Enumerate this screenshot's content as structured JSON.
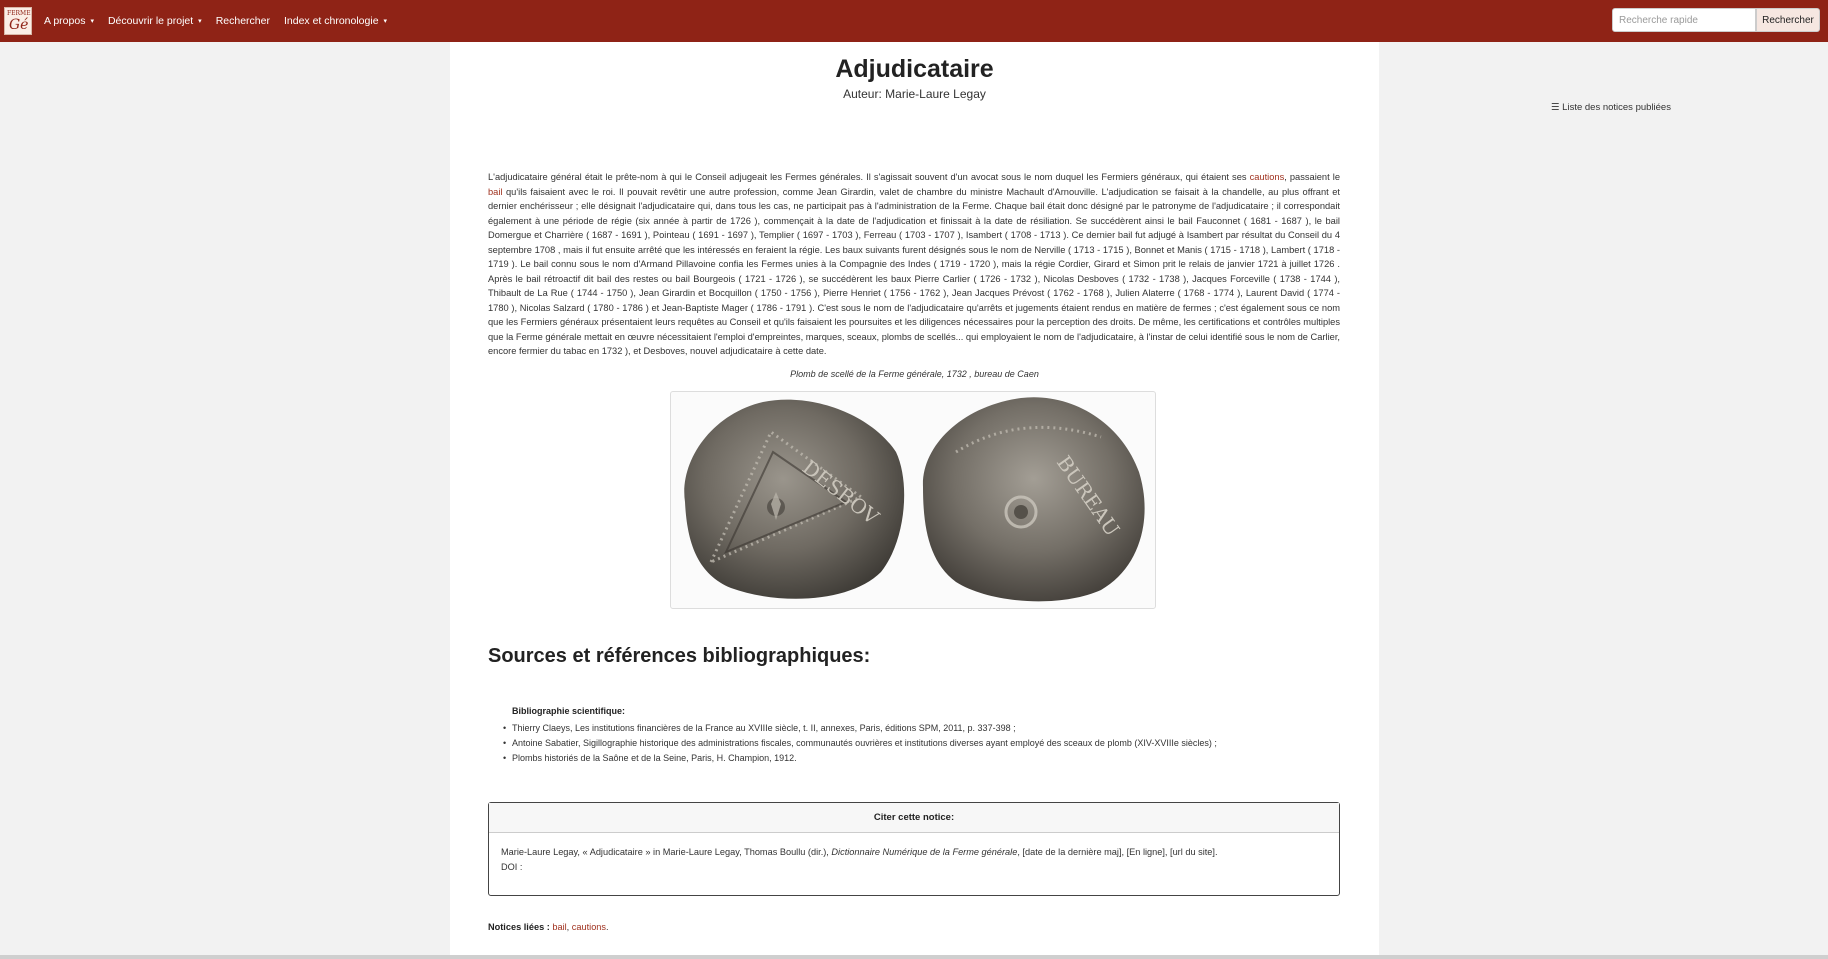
{
  "navbar": {
    "logo_top": "FERME",
    "logo_main": "Gé",
    "items": [
      {
        "label": "A propos",
        "dropdown": true
      },
      {
        "label": "Découvrir le projet",
        "dropdown": true
      },
      {
        "label": "Rechercher",
        "dropdown": false
      },
      {
        "label": "Index et chronologie",
        "dropdown": true
      }
    ],
    "caret": "▾",
    "search_placeholder": "Recherche rapide",
    "search_button": "Rechercher"
  },
  "colors": {
    "navbar": "#8f2316",
    "link": "#a0321f"
  },
  "article": {
    "title": "Adjudicataire",
    "author": "Auteur: Marie-Laure Legay",
    "body": {
      "p1": "L'adjudicataire général était le prête-nom à qui le Conseil adjugeait les Fermes générales. Il s'agissait souvent d'un avocat sous le nom duquel les Fermiers généraux, qui étaient ses ",
      "link_cautions": "cautions",
      "p2": ", passaient le ",
      "link_bail": "bail",
      "p3": " qu'ils faisaient avec le roi. Il pouvait revêtir une autre profession, comme Jean Girardin, valet de chambre du ministre Machault d'Arnouville. L'adjudication se faisait à la chandelle, au plus offrant et dernier enchérisseur ; elle désignait l'adjudicataire qui, dans tous les cas, ne participait pas à l'administration de la Ferme. Chaque bail était donc désigné par le patronyme de l'adjudicataire ; il correspondait également à une période de régie (six année à partir de 1726 ), commençait à la date de l'adjudication et finissait à la date de résiliation. Se succédèrent ainsi le bail Fauconnet ( 1681 - 1687 ), le bail Domergue et Charrière ( 1687 - 1691 ), Pointeau ( 1691 - 1697 ), Templier ( 1697 - 1703 ), Ferreau ( 1703 - 1707 ), Isambert ( 1708 - 1713 ). Ce dernier bail fut adjugé à Isambert par résultat du Conseil du 4 septembre 1708 , mais il fut ensuite arrêté que les intéressés en feraient la régie. Les baux suivants furent désignés sous le nom de Nerville ( 1713 - 1715 ), Bonnet et Manis ( 1715 - 1718 ), Lambert ( 1718 - 1719 ). Le bail connu sous le nom d'Armand Pillavoine confia les Fermes unies à la Compagnie des Indes ( 1719 - 1720 ), mais la régie Cordier, Girard et Simon prit le relais de janvier 1721 à juillet 1726 . Après le bail rétroactif dit bail des restes ou bail Bourgeois ( 1721 - 1726 ), se succédèrent les baux Pierre Carlier ( 1726 - 1732 ), Nicolas Desboves ( 1732 - 1738 ), Jacques Forceville ( 1738 - 1744 ), Thibault de La Rue ( 1744 - 1750 ), Jean Girardin et Bocquillon ( 1750 - 1756 ), Pierre Henriet ( 1756 - 1762 ), Jean Jacques Prévost ( 1762 - 1768 ), Julien Alaterre ( 1768 - 1774 ), Laurent David ( 1774 - 1780 ), Nicolas Salzard ( 1780 - 1786 ) et Jean-Baptiste Mager ( 1786 - 1791 ). C'est sous le nom de l'adjudicataire qu'arrêts et jugements étaient rendus en matière de fermes ; c'est également sous ce nom que les Fermiers généraux présentaient leurs requêtes au Conseil et qu'ils faisaient les poursuites et les diligences nécessaires pour la perception des droits. De même, les certifications et contrôles multiples que la Ferme générale mettait en œuvre nécessitaient l'emploi d'empreintes, marques, sceaux, plombs de scellés... qui employaient le nom de l'adjudicataire, à l'instar de celui identifié sous le nom de Carlier, encore fermier du tabac en 1732 ), et Desboves, nouvel adjudicataire à cette date."
    },
    "image_caption": "Plomb de scellé de la Ferme générale, 1732 , bureau de Caen",
    "left_seal_text": "DESBOV",
    "right_seal_text": "BUREAU"
  },
  "sources": {
    "heading": "Sources et références bibliographiques:",
    "subheading": "Bibliographie scientifique:",
    "items": [
      "Thierry Claeys, Les institutions financières de la France au XVIIIe siècle, t. II, annexes, Paris, éditions SPM, 2011, p. 337-398 ;",
      "Antoine Sabatier, Sigillographie historique des administrations fiscales, communautés ouvrières et institutions diverses ayant employé des sceaux de plomb (XIV-XVIIIe siècles) ;",
      "Plombs historiés de la Saône et de la Seine, Paris, H. Champion, 1912."
    ]
  },
  "citation": {
    "heading": "Citer cette notice:",
    "text1": "Marie-Laure Legay, « Adjudicataire » in Marie-Laure Legay, Thomas Boullu (dir.), ",
    "text_italic": "Dictionnaire Numérique de la Ferme générale",
    "text2": ", [date de la dernière maj], [En ligne], [url du site].",
    "doi": "DOI :"
  },
  "related": {
    "label": "Notices liées :",
    "link1": "bail",
    "sep": ", ",
    "link2": "cautions",
    "end": "."
  },
  "sidebar": {
    "list_icon": "☰",
    "list_label": "Liste des notices publiées"
  }
}
